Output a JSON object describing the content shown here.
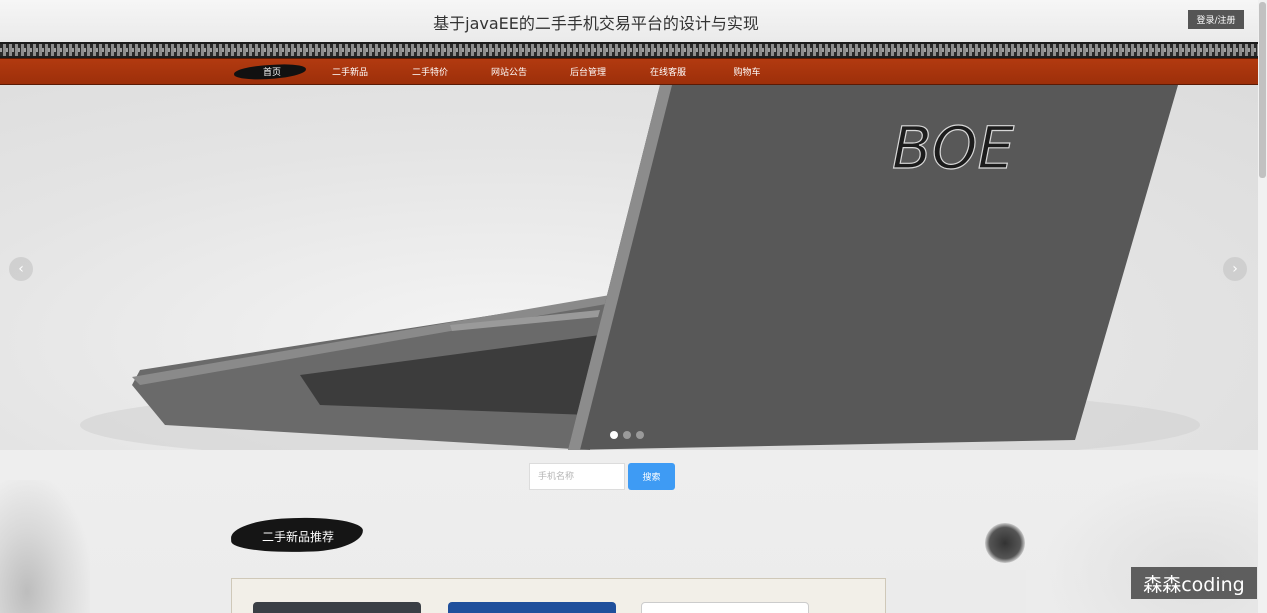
{
  "header": {
    "title": "基于javaEE的二手手机交易平台的设计与实现",
    "login_label": "登录/注册"
  },
  "nav": {
    "items": [
      {
        "label": "首页",
        "active": true
      },
      {
        "label": "二手新品",
        "active": false
      },
      {
        "label": "二手特价",
        "active": false
      },
      {
        "label": "网站公告",
        "active": false
      },
      {
        "label": "后台管理",
        "active": false
      },
      {
        "label": "在线客服",
        "active": false
      },
      {
        "label": "购物车",
        "active": false
      }
    ]
  },
  "banner": {
    "logo_text": "BOE",
    "slide_count": 3,
    "active_slide": 1,
    "prev_icon": "chevron-left-icon",
    "next_icon": "chevron-right-icon"
  },
  "search": {
    "placeholder": "手机名称",
    "value": "",
    "button_label": "搜索"
  },
  "section": {
    "heading": "二手新品推荐"
  },
  "watermark": "森森coding",
  "colors": {
    "nav_background": "#a8330c",
    "search_button": "#3e9bf4",
    "login_button": "#555555",
    "ink": "#151515"
  }
}
